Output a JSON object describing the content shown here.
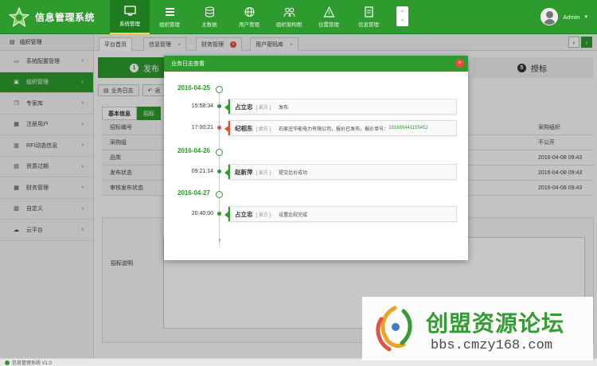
{
  "app": {
    "title": "信息管理系统",
    "user": "Admin"
  },
  "nav": [
    {
      "label": "系统管理",
      "icon": "monitor-icon"
    },
    {
      "label": "组织管理",
      "icon": "list-icon"
    },
    {
      "label": "主数据",
      "icon": "database-icon"
    },
    {
      "label": "用户管理",
      "icon": "globe-icon"
    },
    {
      "label": "组织架构图",
      "icon": "users-icon"
    },
    {
      "label": "位置管理",
      "icon": "location-icon"
    },
    {
      "label": "信息管理",
      "icon": "document-icon"
    }
  ],
  "sidebar": {
    "header": "组织管理",
    "items": [
      {
        "label": "系统配置管理",
        "icon": "monitor-icon"
      },
      {
        "label": "组织管理",
        "icon": "card-icon"
      },
      {
        "label": "专家库",
        "icon": "copy-icon"
      },
      {
        "label": "注册用户",
        "icon": "image-icon"
      },
      {
        "label": "RFI动态信息",
        "icon": "rfi-icon"
      },
      {
        "label": "资质过期",
        "icon": "file-icon"
      },
      {
        "label": "财务管理",
        "icon": "table-icon"
      },
      {
        "label": "自定义",
        "icon": "calendar-icon"
      },
      {
        "label": "云平台",
        "icon": "cloud-icon"
      }
    ]
  },
  "tabs": [
    {
      "label": "平台首页"
    },
    {
      "label": "信息管理"
    },
    {
      "label": "财务管理"
    },
    {
      "label": "用户密码库"
    }
  ],
  "steps": {
    "first": {
      "num": "1",
      "label": "发布"
    },
    "last": {
      "num": "5",
      "label": "授标"
    }
  },
  "toolbar": {
    "log": "业务日志",
    "back": "返"
  },
  "subtabs": {
    "basic": "基本信息",
    "other": "招标"
  },
  "grid": {
    "labels": [
      "招标编号",
      "采购组",
      "品类",
      "发布状态",
      "审核发布状态"
    ],
    "right_header": "采购组织",
    "right_values": [
      "不公开",
      "2016-04-08 09:43",
      "2016-04-08 09:43",
      "2016-04-08 09:43"
    ],
    "desc_label": "招标说明"
  },
  "status": {
    "text": "信息管理系统 V1.0"
  },
  "modal": {
    "title": "业务日志查看",
    "groups": [
      {
        "date": "2016-04-25",
        "entries": [
          {
            "time": "15:58:34",
            "name": "占立忠",
            "role": "[ 采方 ]",
            "action": "发布",
            "number": "",
            "color": "green"
          },
          {
            "time": "17:00:21",
            "name": "纪相东",
            "role": "[ 供方 ]",
            "action": "石家庄华能电力有限公司，报价已发布，报价单号：",
            "number": "191685441155452",
            "color": "red"
          }
        ]
      },
      {
        "date": "2016-04-26",
        "entries": [
          {
            "time": "09:21:14",
            "name": "赵新萍",
            "role": "[ 采方 ]",
            "action": "提交比价成功",
            "number": "",
            "color": "green"
          }
        ]
      },
      {
        "date": "2016-04-27",
        "entries": [
          {
            "time": "20:40:00",
            "name": "占立忠",
            "role": "[ 采方 ]",
            "action": "设置比较完成",
            "number": "",
            "color": "green"
          }
        ]
      }
    ]
  },
  "watermark": {
    "title": "创盟资源论坛",
    "url": "bbs.cmzy168.com"
  },
  "colors": {
    "primary": "#2e9b2e",
    "danger": "#e2503b"
  }
}
